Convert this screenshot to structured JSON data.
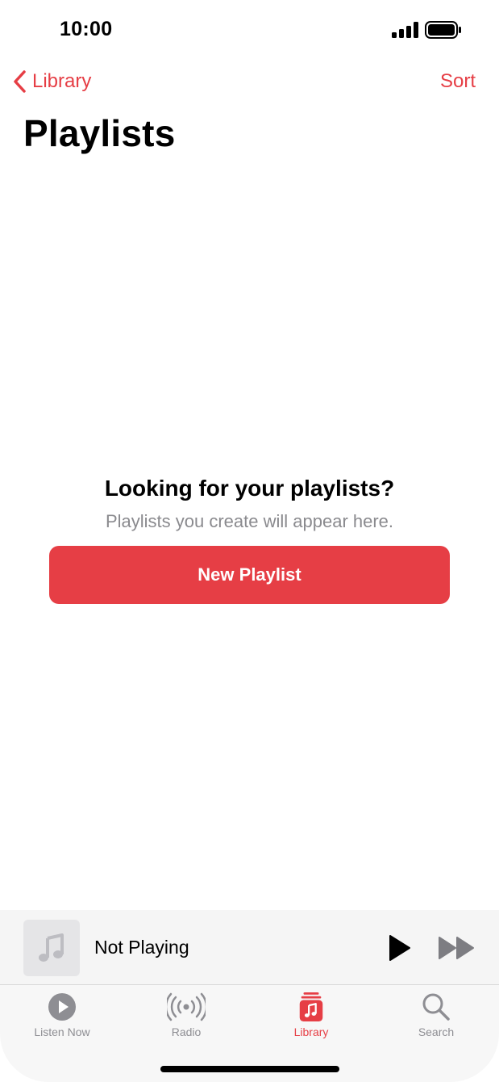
{
  "status_bar": {
    "time": "10:00"
  },
  "nav": {
    "back_label": "Library",
    "sort_label": "Sort",
    "title": "Playlists"
  },
  "empty_state": {
    "title": "Looking for your playlists?",
    "subtitle": "Playlists you create will appear here.",
    "button_label": "New Playlist"
  },
  "mini_player": {
    "title": "Not Playing",
    "artwork_icon": "music-note-icon",
    "play_icon": "play-icon",
    "forward_icon": "fast-forward-icon"
  },
  "tab_bar": {
    "items": [
      {
        "label": "Listen Now",
        "icon": "play-circle-icon",
        "active": false
      },
      {
        "label": "Radio",
        "icon": "radio-waves-icon",
        "active": false
      },
      {
        "label": "Library",
        "icon": "library-music-icon",
        "active": true
      },
      {
        "label": "Search",
        "icon": "search-icon",
        "active": false
      }
    ]
  },
  "colors": {
    "accent": "#e63e45",
    "inactive": "#8e8e93",
    "secondary_text": "#8a8a8e",
    "mini_player_bg": "#f5f5f5"
  }
}
